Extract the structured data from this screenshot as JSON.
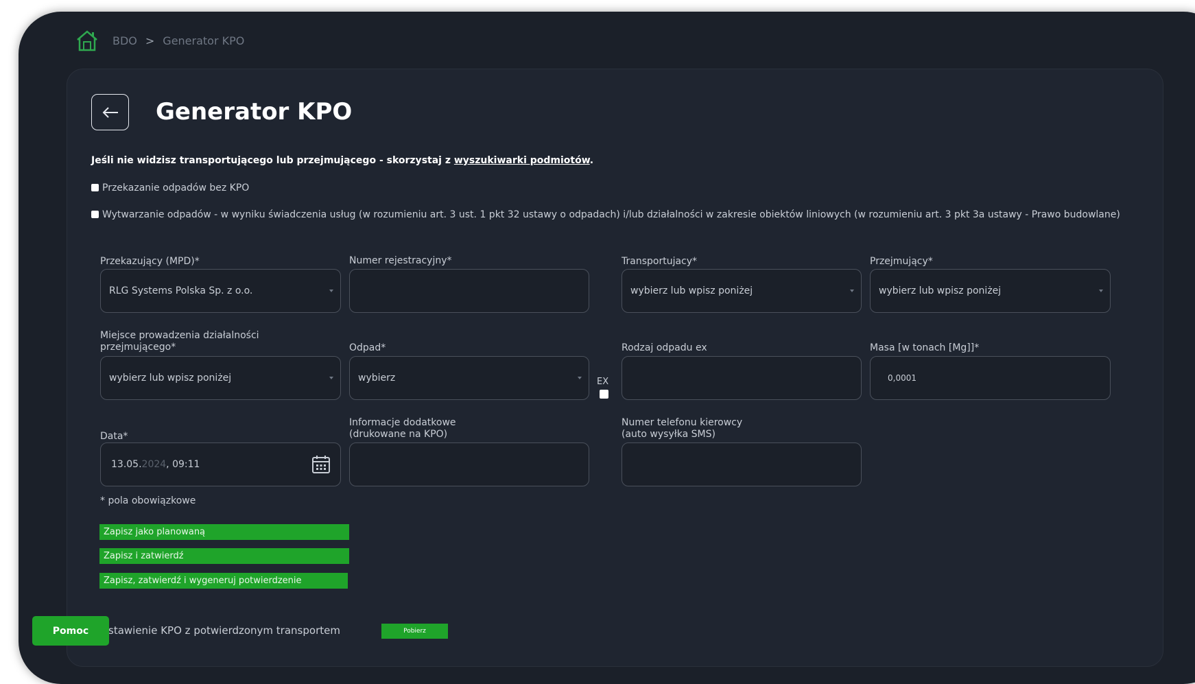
{
  "breadcrumb": {
    "root": "BDO",
    "separator": ">",
    "current": "Generator KPO"
  },
  "page": {
    "title": "Generator KPO",
    "back_icon": "arrow-left-icon"
  },
  "notice": {
    "text_before": "Jeśli nie widzisz transportującego lub przejmującego - skorzystaj z ",
    "link_text": "wyszukiwarki podmiotów",
    "text_after": "."
  },
  "checkboxes": [
    {
      "label": "Przekazanie odpadów bez KPO",
      "checked": false
    },
    {
      "label": "Wytwarzanie odpadów - w wyniku świadczenia usług (w rozumieniu art. 3 ust. 1 pkt 32 ustawy o odpadach) i/lub działalności w zakresie obiektów liniowych (w rozumieniu art. 3 pkt 3a ustawy - Prawo budowlane)",
      "checked": false
    }
  ],
  "form": {
    "przekazujacy": {
      "label": "Przekazujący (MPD)*",
      "value": "RLG Systems Polska Sp. z o.o."
    },
    "numer_rej": {
      "label": "Numer rejestracyjny*",
      "value": ""
    },
    "transportujacy": {
      "label": "Transportujacy*",
      "value": "wybierz lub wpisz poniżej"
    },
    "przejmujacy": {
      "label": "Przejmujący*",
      "value": "wybierz lub wpisz poniżej"
    },
    "miejsce": {
      "label_line1": "Miejsce prowadzenia działalności",
      "label_line2": "przejmującego*",
      "value": "wybierz lub wpisz poniżej"
    },
    "odpad": {
      "label": "Odpad*",
      "value": "wybierz"
    },
    "ex": {
      "label": "EX",
      "checked": false
    },
    "rodzaj_ex": {
      "label": "Rodzaj odpadu ex",
      "value": ""
    },
    "masa": {
      "label": "Masa [w tonach [Mg]]*",
      "value": "0,0001"
    },
    "data": {
      "label": "Data*",
      "value_day": "13.05.",
      "value_year": "2024",
      "value_time": ", 09:11"
    },
    "info": {
      "label_line1": "Informacje dodatkowe",
      "label_line2": "(drukowane na KPO)",
      "value": ""
    },
    "telefon": {
      "label_line1": "Numer telefonu kierowcy",
      "label_line2": "(auto wysyłka SMS)",
      "value": ""
    }
  },
  "required_note": "* pola obowiązkowe",
  "actions": {
    "save_planned": "Zapisz jako planowaną",
    "save_confirm": "Zapisz i zatwierdź",
    "save_confirm_generate": "Zapisz, zatwierdź i wygeneruj potwierdzenie"
  },
  "bottom": {
    "text": "stawienie KPO z potwierdzonym transportem",
    "download": "Pobierz"
  },
  "help": "Pomoc",
  "colors": {
    "accent_green": "#1fa42a",
    "background": "#1b2029"
  }
}
